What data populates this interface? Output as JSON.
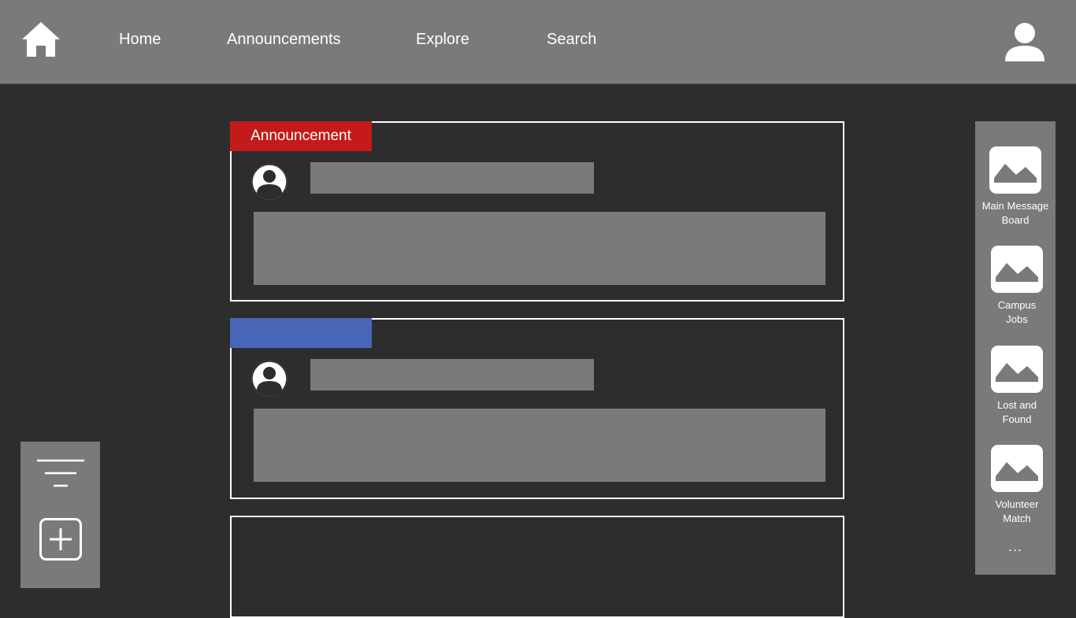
{
  "nav": {
    "home_icon": "house-icon",
    "links": [
      "Home",
      "Announcements",
      "Explore",
      "Search"
    ],
    "profile_icon": "user-icon"
  },
  "posts": [
    {
      "tag": "Announcement",
      "tag_color": "#c41a1a"
    },
    {
      "tag": "",
      "tag_color": "#4a66b8"
    },
    {
      "tag": "",
      "tag_color": ""
    }
  ],
  "tools": {
    "filter_icon": "filter-icon",
    "add_icon": "add-post-icon"
  },
  "boards": {
    "items": [
      {
        "label_line1": "Main Message",
        "label_line2": "Board"
      },
      {
        "label_line1": "Campus",
        "label_line2": "Jobs"
      },
      {
        "label_line1": "Lost and",
        "label_line2": "Found"
      },
      {
        "label_line1": "Volunteer",
        "label_line2": "Match"
      }
    ],
    "more": "..."
  },
  "colors": {
    "background": "#2d2d2d",
    "bars": "#7a7a7a",
    "announcement": "#c41a1a",
    "secondary_tag": "#4a66b8"
  }
}
